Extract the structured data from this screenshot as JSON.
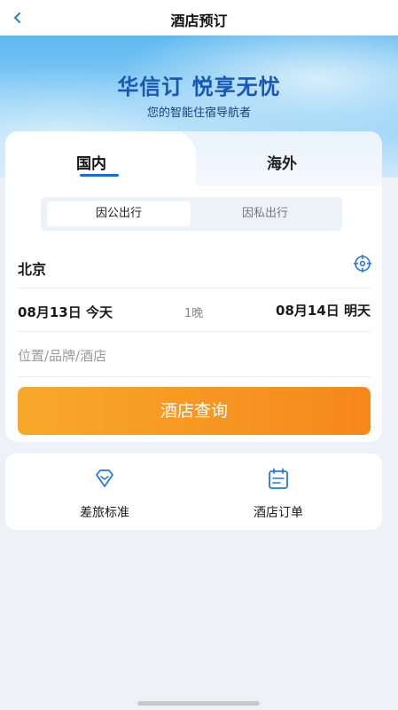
{
  "header": {
    "title": "酒店预订",
    "back_icon": "chevron-left-icon"
  },
  "hero": {
    "headline": "华信订 悦享无忧",
    "subtitle": "您的智能住宿导航者"
  },
  "tabs": [
    {
      "label": "国内",
      "active": true
    },
    {
      "label": "海外",
      "active": false
    }
  ],
  "trip_type": {
    "options": [
      {
        "label": "因公出行",
        "selected": true
      },
      {
        "label": "因私出行",
        "selected": false
      }
    ]
  },
  "search": {
    "city": "北京",
    "locate_icon": "locate-icon",
    "check_in": "08月13日 今天",
    "nights": "1晚",
    "check_out": "08月14日 明天",
    "keyword_placeholder": "位置/品牌/酒店",
    "submit_label": "酒店查询"
  },
  "quick_links": [
    {
      "label": "差旅标准",
      "icon": "diamond-icon"
    },
    {
      "label": "酒店订单",
      "icon": "calendar-list-icon"
    }
  ],
  "colors": {
    "accent_blue": "#1a6ad6",
    "button_orange": "#f7871c",
    "hero_title": "#1757b8"
  }
}
